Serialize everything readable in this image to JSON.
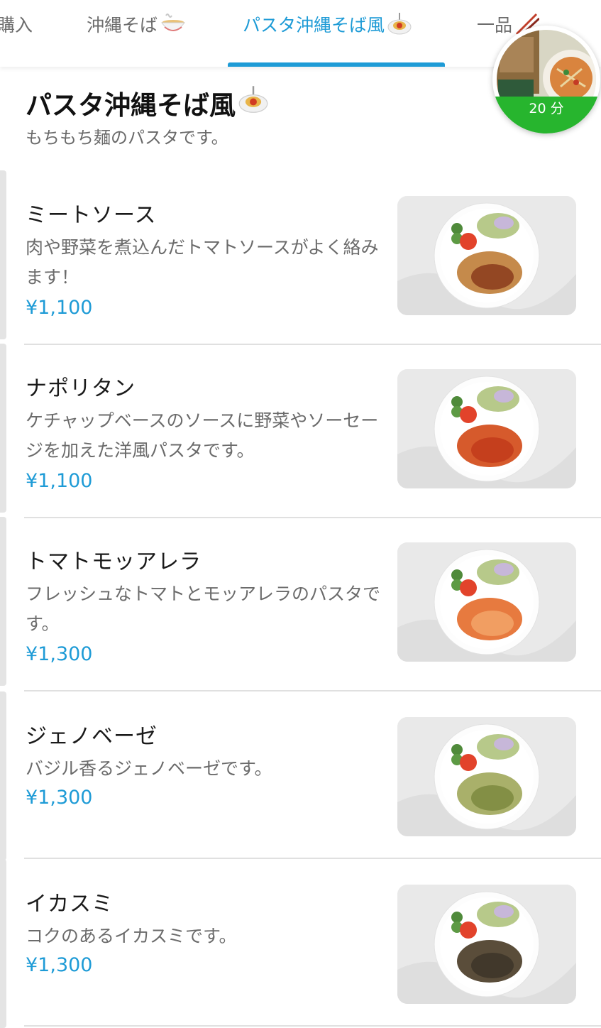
{
  "tabs": [
    {
      "label": "購入",
      "emoji": "",
      "active": false
    },
    {
      "label": "沖縄そば",
      "emoji": "noodle-bowl",
      "active": false
    },
    {
      "label": "パスタ沖縄そば風",
      "emoji": "spaghetti",
      "active": true
    },
    {
      "label": "一品",
      "emoji": "chopsticks",
      "active": false
    }
  ],
  "time_badge": {
    "label": "20 分"
  },
  "section": {
    "title": "パスタ沖縄そば風",
    "subtitle": "もちもち麺のパスタです。"
  },
  "menu_items": [
    {
      "name": "ミートソース",
      "description": "肉や野菜を煮込んだトマトソースがよく絡みます！",
      "price": "¥1,100",
      "pasta_color": "#c58a4b",
      "sauce_color": "#8a3b1c"
    },
    {
      "name": "ナポリタン",
      "description": "ケチャップベースのソースに野菜やソーセージを加えた洋風パスタです。",
      "price": "¥1,100",
      "pasta_color": "#d65a2c",
      "sauce_color": "#c23b1b"
    },
    {
      "name": "トマトモッアレラ",
      "description": "フレッシュなトマトとモッアレラのパスタです。",
      "price": "¥1,300",
      "pasta_color": "#e77a3f",
      "sauce_color": "#f2a468"
    },
    {
      "name": "ジェノベーゼ",
      "description": "バジル香るジェノベーゼです。",
      "price": "¥1,300",
      "pasta_color": "#a9b06a",
      "sauce_color": "#7d8a3e"
    },
    {
      "name": "イカスミ",
      "description": "コクのあるイカスミです。",
      "price": "¥1,300",
      "pasta_color": "#5a4d3a",
      "sauce_color": "#3d3529"
    }
  ],
  "colors": {
    "accent": "#1e9bd6",
    "badge_green": "#27b52e",
    "text_muted": "#6b6b6b"
  }
}
